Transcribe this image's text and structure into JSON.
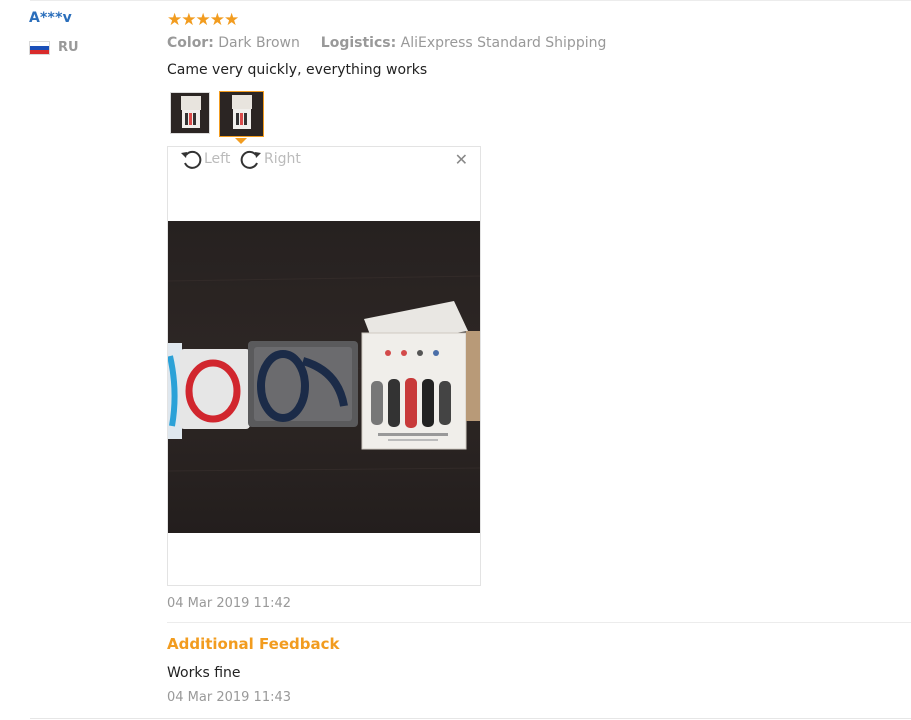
{
  "user": {
    "name": "A***v",
    "country_code": "RU",
    "flag_colors": [
      "#ffffff",
      "#1a4fb8",
      "#d92b2b"
    ]
  },
  "review": {
    "rating": 5,
    "stars": "★★★★★",
    "star_color": "#f29c1f",
    "attributes": [
      {
        "key": "Color:",
        "value": "Dark Brown"
      },
      {
        "key": "Logistics:",
        "value": "AliExpress Standard Shipping"
      }
    ],
    "text": "Came very quickly, everything works",
    "date": "04 Mar 2019 11:42",
    "image_count": 2,
    "selected_image": 2
  },
  "viewer": {
    "rotate_left_label": "Left",
    "rotate_right_label": "Right",
    "close_icon": "close-icon"
  },
  "additional_feedback": {
    "title": "Additional Feedback",
    "text": "Works fine",
    "date": "04 Mar 2019 11:43"
  }
}
